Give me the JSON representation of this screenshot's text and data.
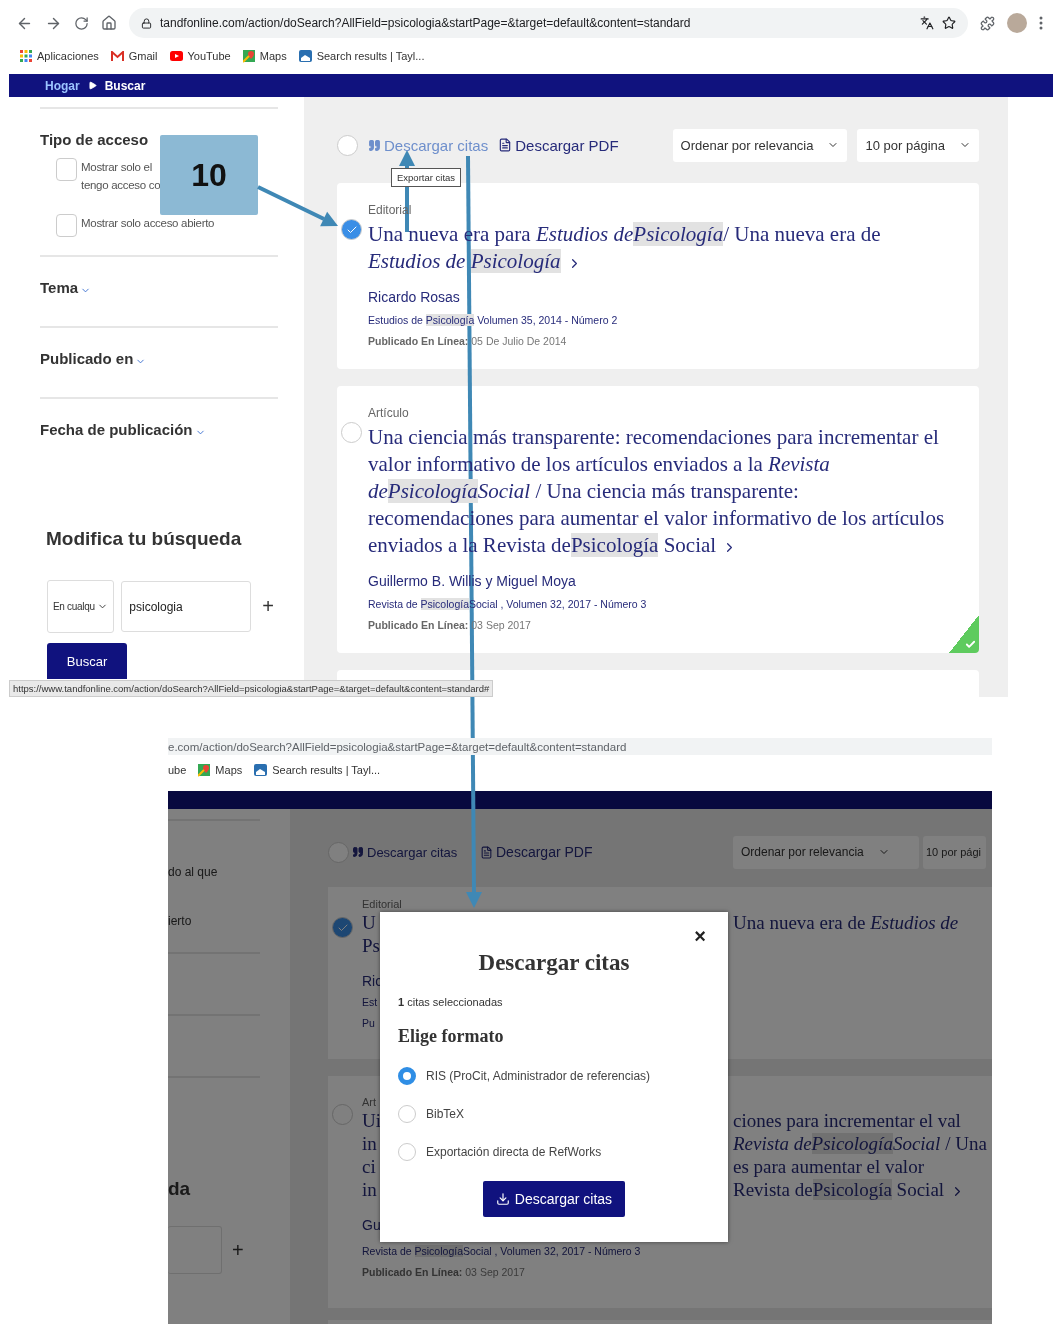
{
  "top": {
    "browser": {
      "url": "tandfonline.com/action/doSearch?AllField=psicologia&startPage=&target=default&content=standard",
      "bookmarks": [
        {
          "label": "Aplicaciones",
          "kind": "apps"
        },
        {
          "label": "Gmail",
          "kind": "mail"
        },
        {
          "label": "YouTube",
          "kind": "video"
        },
        {
          "label": "Maps",
          "kind": "map"
        },
        {
          "label": "Search results | Tayl...",
          "kind": "site"
        }
      ]
    },
    "breadcrumb": [
      {
        "label": "Hogar",
        "selected": false
      },
      {
        "label": "Buscar",
        "selected": true
      }
    ],
    "sidebar": {
      "access_title": "Tipo de acceso",
      "access_options": [
        {
          "lines": [
            "Mostrar solo el",
            "tengo acceso co"
          ],
          "checked": false
        },
        {
          "lines": [
            "Mostrar solo acceso abierto"
          ],
          "checked": false
        }
      ],
      "filters": [
        "Tema",
        "Publicado en",
        "Fecha de publicación"
      ],
      "modify": {
        "title": "Modifica tu búsqueda",
        "field": "En cualqu",
        "query": "psicologia",
        "add": "+",
        "button": "Buscar"
      }
    },
    "toolbar": {
      "select_all": false,
      "cite": "Descargar citas",
      "pdf": "Descargar PDF",
      "sort": "Ordenar por relevancia",
      "per_page": "10 por página",
      "tooltip": "Exportar citas"
    },
    "results": [
      {
        "type": "Editorial",
        "selected": true,
        "open_access": false,
        "title": [
          {
            "text": "Una nueva era para ",
            "italic": false,
            "highlight": false
          },
          {
            "text": "Estudios de",
            "italic": true,
            "highlight": false
          },
          {
            "text": "Psicología",
            "italic": true,
            "highlight": true
          },
          {
            "text": "/ Una nueva era de ",
            "italic": false,
            "highlight": false
          },
          {
            "text": "Estudios de ",
            "italic": true,
            "highlight": false
          },
          {
            "text": "Psicología",
            "italic": true,
            "highlight": true
          }
        ],
        "authors": "Ricardo Rosas",
        "source": [
          {
            "text": "Estudios de ",
            "highlight": false
          },
          {
            "text": "Psicología",
            "highlight": true
          },
          {
            "text": " Volumen 35, 2014 - Número 2",
            "highlight": false
          }
        ],
        "date_label": "Publicado En Línea:",
        "date": "05 De Julio De 2014"
      },
      {
        "type": "Artículo",
        "selected": false,
        "open_access": true,
        "title": [
          {
            "text": "Una ciencia más transparente: recomendaciones para incrementar el valor informativo de los artículos enviados a la ",
            "italic": false,
            "highlight": false
          },
          {
            "text": "Revista de",
            "italic": true,
            "highlight": false
          },
          {
            "text": "Psicología",
            "italic": true,
            "highlight": true
          },
          {
            "text": "Social",
            "italic": true,
            "highlight": false
          },
          {
            "text": " / Una ciencia más transparente: recomendaciones para aumentar el valor informativo de los artículos enviados a la Revista de",
            "italic": false,
            "highlight": false
          },
          {
            "text": "Psicología",
            "italic": false,
            "highlight": true
          },
          {
            "text": " Social",
            "italic": false,
            "highlight": false
          }
        ],
        "authors": "Guillermo B. Willis y Miguel Moya",
        "source": [
          {
            "text": "Revista de ",
            "highlight": false
          },
          {
            "text": "Psicología",
            "highlight": true
          },
          {
            "text": "Social , Volumen 32, 2017 - Número 3",
            "highlight": false
          }
        ],
        "date_label": "Publicado En Línea:",
        "date": "03 Sep 2017"
      }
    ],
    "status_url": "https://www.tandfonline.com/action/doSearch?AllField=psicologia&startPage=&target=default&content=standard#",
    "callout": "10"
  },
  "bottom": {
    "url": "e.com/action/doSearch?AllField=psicologia&startPage=&target=default&content=standard",
    "bookmarks": [
      {
        "label": "ube",
        "kind": "none"
      },
      {
        "label": "Maps",
        "kind": "map"
      },
      {
        "label": "Search results | Tayl...",
        "kind": "site"
      }
    ],
    "sidebar": {
      "options": [
        "do al que",
        "ierto"
      ],
      "heading": "da",
      "add": "+"
    },
    "toolbar": {
      "select_all": false,
      "cite": "Descargar citas",
      "pdf": "Descargar PDF",
      "sort": "Ordenar por relevancia",
      "per_page": "10 por pági"
    },
    "cards": [
      {
        "type": "Editorial",
        "selected": true,
        "lines": [
          {
            "kind": "title",
            "left": "U",
            "right": [
              {
                "text": "Una nueva era de ",
                "italic": false,
                "highlight": false
              },
              {
                "text": "Estudios de",
                "italic": true,
                "highlight": false
              }
            ]
          },
          {
            "kind": "title",
            "left": "Ps"
          },
          {
            "kind": "author",
            "left": "Ric"
          },
          {
            "kind": "meta",
            "left": "Est"
          },
          {
            "kind": "meta",
            "left": "Pu"
          }
        ]
      },
      {
        "type": "Art",
        "selected": false,
        "lines": [
          {
            "kind": "title",
            "left": "Ui",
            "right": [
              {
                "text": "ciones para incrementar el val",
                "italic": false,
                "highlight": false
              }
            ]
          },
          {
            "kind": "title",
            "left": "in",
            "right": [
              {
                "text": "Revista de",
                "italic": true,
                "highlight": false
              },
              {
                "text": "Psicología",
                "italic": true,
                "highlight": true
              },
              {
                "text": "Social",
                "italic": true,
                "highlight": false
              },
              {
                "text": " / Una",
                "italic": false,
                "highlight": false
              }
            ]
          },
          {
            "kind": "title",
            "left": "ci",
            "right": [
              {
                "text": "es para aumentar el valor",
                "italic": false,
                "highlight": false
              }
            ]
          },
          {
            "kind": "title",
            "left": "in",
            "right": [
              {
                "text": "Revista de",
                "italic": false,
                "highlight": false
              },
              {
                "text": "Psicología",
                "italic": false,
                "highlight": true
              },
              {
                "text": " Social",
                "italic": false,
                "highlight": false
              }
            ],
            "chevron": true
          },
          {
            "kind": "author",
            "left": "Gu"
          }
        ],
        "source": [
          {
            "text": "Revista de ",
            "highlight": false
          },
          {
            "text": "Psicología",
            "highlight": true
          },
          {
            "text": "Social , Volumen 32, 2017 - Número 3",
            "highlight": false
          }
        ],
        "date_label": "Publicado En Línea:",
        "date": "03 Sep 2017"
      }
    ]
  },
  "modal": {
    "close": "×",
    "title": "Descargar citas",
    "count": "**1** citas seleccionadas",
    "format_title": "Elige formato",
    "options": [
      {
        "label": "RIS (ProCit, Administrador de referencias)",
        "selected": true
      },
      {
        "label": "BibTeX",
        "selected": false
      },
      {
        "label": "Exportación directa de RefWorks",
        "selected": false
      }
    ],
    "button": "Descargar citas"
  }
}
